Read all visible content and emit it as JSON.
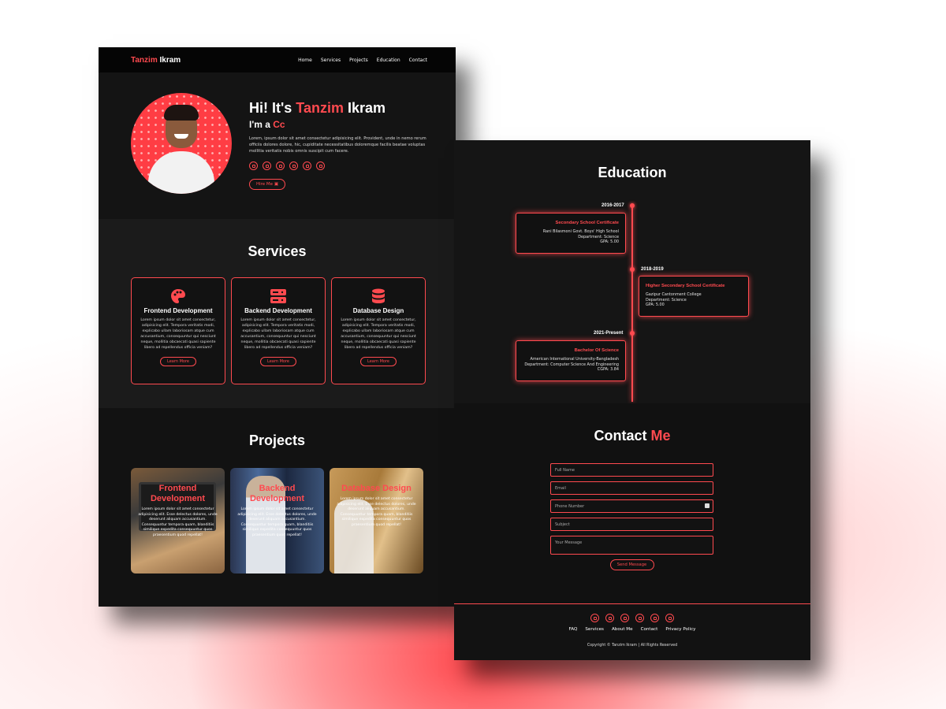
{
  "nav": {
    "brand_first": "Tanzim",
    "brand_last": "Ikram",
    "links": [
      "Home",
      "Services",
      "Projects",
      "Education",
      "Contact"
    ]
  },
  "hero": {
    "title_prefix": "Hi! It's",
    "title_name_first": "Tanzim",
    "title_name_last": "Ikram",
    "subtitle_prefix": "I'm a",
    "subtitle_typed": "Cc",
    "description": "Lorem, ipsum dolor sit amet consectetur adipisicing elit. Provident, unde in nemo rerum officiis dolores dolore, hic, cupiditate necessitatibus doloremque facilis beatae voluptas mollitia veritatis nobis omnis suscipit cum facere.",
    "hire_label": "Hire Me",
    "socials": [
      "envelope-icon",
      "instagram-icon",
      "linkedin-icon",
      "github-icon",
      "facebook-icon",
      "youtube-icon"
    ]
  },
  "services": {
    "title": "Services",
    "cards": [
      {
        "icon": "palette-icon",
        "title": "Frontend Development",
        "text": "Lorem ipsum dolor sit amet consectetur, adipisicing elit. Tempora veritatis modi, explicabo ullam laboriosam atque cum accusantium, consequuntur qui nesciunt neque, mollitia obcaecati quasi sapiente libero ad repellendus officia veniam?",
        "button": "Learn More"
      },
      {
        "icon": "server-icon",
        "title": "Backend Development",
        "text": "Lorem ipsum dolor sit amet consectetur, adipisicing elit. Tempora veritatis modi, explicabo ullam laboriosam atque cum accusantium, consequuntur qui nesciunt neque, mollitia obcaecati quasi sapiente libero ad repellendus officia veniam?",
        "button": "Learn More"
      },
      {
        "icon": "database-icon",
        "title": "Database Design",
        "text": "Lorem ipsum dolor sit amet consectetur, adipisicing elit. Tempora veritatis modi, explicabo ullam laboriosam atque cum accusantium, consequuntur qui nesciunt neque, mollitia obcaecati quasi sapiente libero ad repellendus officia veniam?",
        "button": "Learn More"
      }
    ]
  },
  "projects": {
    "title": "Projects",
    "items": [
      {
        "title": "Frontend Development",
        "text": "Lorem ipsum dolor sit amet consectetur adipisicing elit. Esse delectus dolores, unde deserunt aliquam accusantium. Consequuntur tempora quam, blanditiis similique expedita consequuntur quos praesentium quod repellat!"
      },
      {
        "title": "Backend Development",
        "text": "Lorem ipsum dolor sit amet consectetur adipisicing elit. Esse delectus dolores, unde deserunt aliquam accusantium. Consequuntur tempora quam, blanditiis similique expedita consequuntur quos praesentium quod repellat!"
      },
      {
        "title": "Database Design",
        "text": "Lorem ipsum dolor sit amet consectetur adipisicing elit. Esse delectus dolores, unde deserunt aliquam accusantium. Consequuntur tempora quam, blanditiis similique expedita consequuntur quos praesentium quod repellat!"
      }
    ]
  },
  "education": {
    "title": "Education",
    "entries": [
      {
        "year": "2016-2017",
        "title": "Secondary School Certificate",
        "lines": [
          "Rani Bilasmoni Govt. Boys' High School",
          "Department: Science",
          "GPA: 5.00"
        ]
      },
      {
        "year": "2018-2019",
        "title": "Higher Secondary School Certificate",
        "lines": [
          "Gazipur Cantonment College",
          "Department: Science",
          "GPA: 5.00"
        ]
      },
      {
        "year": "2021-Present",
        "title": "Bachelor Of Science",
        "lines": [
          "American International University-Bangladesh",
          "Department: Computer Science And Engineering",
          "CGPA: 3.84"
        ]
      }
    ]
  },
  "contact": {
    "title_first": "Contact",
    "title_accent": "Me",
    "placeholders": {
      "name": "Full Name",
      "email": "Email",
      "phone": "Phone Number",
      "subject": "Subject",
      "message": "Your Message"
    },
    "send_label": "Send Message"
  },
  "footer": {
    "socials": [
      "envelope-icon",
      "instagram-icon",
      "linkedin-icon",
      "github-icon",
      "facebook-icon",
      "youtube-icon"
    ],
    "links": [
      "FAQ",
      "Services",
      "About Me",
      "Contact",
      "Privacy Policy"
    ],
    "copyright": "Copyright © Tanzim Ikram | All Rights Reserved"
  },
  "colors": {
    "accent": "#ff4a4f",
    "background": "#121212",
    "nav": "#050505"
  }
}
